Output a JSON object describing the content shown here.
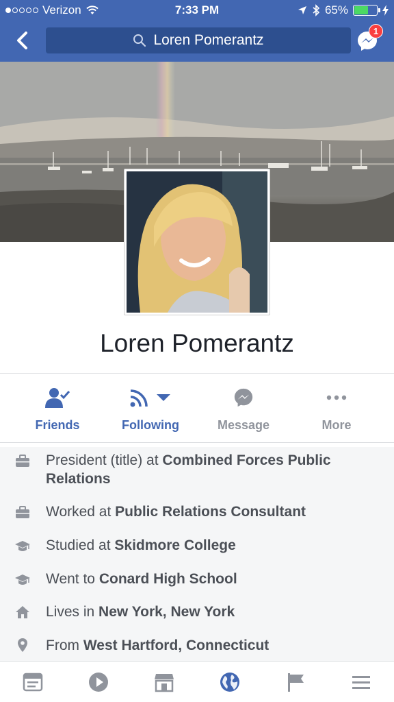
{
  "status_bar": {
    "carrier": "Verizon",
    "time": "7:33 PM",
    "battery": "65%",
    "battery_level": 0.65
  },
  "nav": {
    "search_text": "Loren Pomerantz",
    "messenger_badge": "1"
  },
  "profile": {
    "name": "Loren Pomerantz"
  },
  "actions": [
    {
      "label": "Friends",
      "icon": "friends-check-icon"
    },
    {
      "label": "Following",
      "icon": "rss-icon"
    },
    {
      "label": "Message",
      "icon": "messenger-icon"
    },
    {
      "label": "More",
      "icon": "more-icon"
    }
  ],
  "about": [
    {
      "icon": "briefcase-icon",
      "prefix": "President (title) at ",
      "bold": "Combined Forces Public Relations"
    },
    {
      "icon": "briefcase-icon",
      "prefix": "Worked at ",
      "bold": "Public Relations Consultant"
    },
    {
      "icon": "graduation-cap-icon",
      "prefix": "Studied at ",
      "bold": "Skidmore College"
    },
    {
      "icon": "graduation-cap-icon",
      "prefix": "Went to ",
      "bold": "Conard High School"
    },
    {
      "icon": "home-icon",
      "prefix": "Lives in ",
      "bold": "New York, New York"
    },
    {
      "icon": "location-pin-icon",
      "prefix": "From ",
      "bold": "West Hartford, Connecticut"
    }
  ],
  "tabs": [
    {
      "icon": "news-feed-icon"
    },
    {
      "icon": "video-play-icon"
    },
    {
      "icon": "marketplace-icon"
    },
    {
      "icon": "globe-icon",
      "active": true
    },
    {
      "icon": "pages-flag-icon"
    },
    {
      "icon": "menu-icon"
    }
  ],
  "colors": {
    "brand": "#4267b2",
    "badge": "#fa3e3e",
    "text_secondary": "#90949c"
  }
}
